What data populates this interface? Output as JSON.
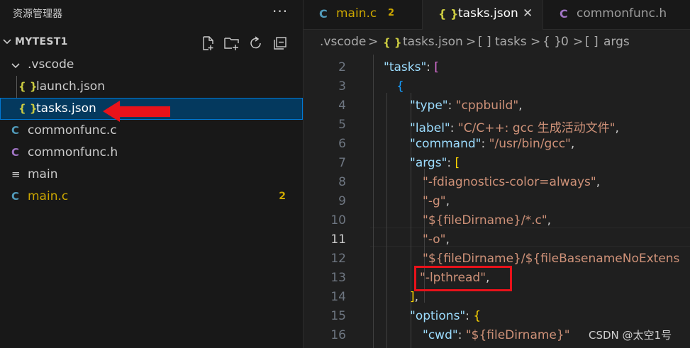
{
  "sidebar": {
    "title": "资源管理器",
    "more": "···",
    "section": "MYTEST1",
    "actions": [
      "new-file-icon",
      "new-folder-icon",
      "refresh-icon",
      "collapse-all-icon"
    ],
    "items": [
      {
        "label": ".vscode",
        "icon": "chevron-down-icon",
        "glyph": "",
        "color": "#cccccc"
      },
      {
        "label": "launch.json",
        "icon": "json-icon",
        "glyph": "{ }",
        "color": "#cccccc"
      },
      {
        "label": "tasks.json",
        "icon": "json-icon",
        "glyph": "{ }",
        "color": "#cccccc"
      },
      {
        "label": "commonfunc.c",
        "icon": "c-file-icon",
        "glyph": "C",
        "color": "#cccccc"
      },
      {
        "label": "commonfunc.h",
        "icon": "h-file-icon",
        "glyph": "C",
        "color": "#cccccc"
      },
      {
        "label": "main",
        "icon": "lines-icon",
        "glyph": "≡",
        "color": "#cccccc"
      },
      {
        "label": "main.c",
        "icon": "c-file-icon",
        "glyph": "C",
        "color": "#cca700",
        "badge": "2"
      }
    ]
  },
  "tabs": [
    {
      "label": "main.c",
      "glyph": "C",
      "count": "2"
    },
    {
      "label": "tasks.json",
      "glyph": "{ }",
      "close": "✕"
    },
    {
      "label": "commonfunc.h",
      "glyph": "C"
    }
  ],
  "breadcrumb": {
    "folder": ".vscode",
    "sep": ">",
    "file_glyph": "{ }",
    "file": "tasks.json",
    "arr_glyph": "[ ]",
    "tasks": "tasks",
    "obj_glyph": "{ }",
    "index": "0",
    "args_glyph": "[ ]",
    "args": "args"
  },
  "editor": {
    "line_numbers": [
      "2",
      "3",
      "4",
      "5",
      "6",
      "7",
      "8",
      "9",
      "10",
      "11",
      "12",
      "13",
      "14",
      "15",
      "16"
    ],
    "current_line": "11",
    "code": {
      "l2_key": "\"tasks\"",
      "l2_colon": ": ",
      "l2_br": "[",
      "l3_br": "{",
      "l4_key": "\"type\"",
      "l4_colon": ": ",
      "l4_val": "\"cppbuild\"",
      "l4_comma": ",",
      "l5_key": "\"label\"",
      "l5_colon": ": ",
      "l5_val": "\"C/C++: gcc 生成活动文件\"",
      "l5_comma": ",",
      "l6_key": "\"command\"",
      "l6_colon": ": ",
      "l6_val": "\"/usr/bin/gcc\"",
      "l6_comma": ",",
      "l7_key": "\"args\"",
      "l7_colon": ": ",
      "l7_br": "[",
      "l8_val": "\"-fdiagnostics-color=always\"",
      "l8_comma": ",",
      "l9_val": "\"-g\"",
      "l9_comma": ",",
      "l10_val": "\"${fileDirname}/*.c\"",
      "l10_comma": ",",
      "l11_val": "\"-o\"",
      "l11_comma": ",",
      "l12_val": "\"${fileDirname}/${fileBasenameNoExtens",
      "l13_val": "\"-lpthread\"",
      "l13_comma": ",",
      "l14_br": "]",
      "l14_comma": ",",
      "l15_key": "\"options\"",
      "l15_colon": ": ",
      "l15_br": "{",
      "l16_key": "\"cwd\"",
      "l16_colon": ": ",
      "l16_val": "\"${fileDirname}\""
    }
  },
  "watermark": "CSDN @太空1号",
  "colors": {
    "accent": "#0078d4",
    "warning": "#cca700",
    "annotation": "#e8121a"
  }
}
